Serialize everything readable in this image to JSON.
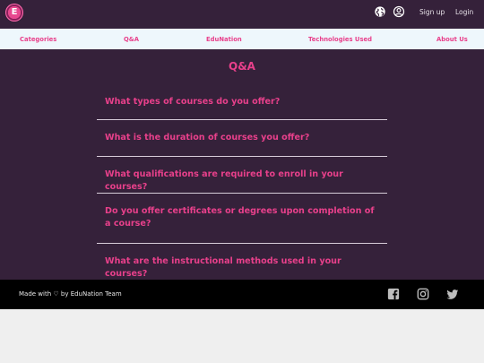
{
  "header": {
    "logo_letter": "E",
    "icons": [
      "globe-icon",
      "user-circle-icon"
    ],
    "signup_label": "Sign up",
    "login_label": "Login"
  },
  "nav": {
    "items": [
      "Categories",
      "Q&A",
      "EduNation",
      "Technologies Used",
      "About Us"
    ]
  },
  "main": {
    "title": "Q&A",
    "questions": [
      "What types of courses do you offer?",
      "What is the duration of courses you offer?",
      "What qualifications are required to enroll in your courses?",
      "Do you offer certificates or degrees upon completion of a course?",
      "What are the instructional methods used in your courses?"
    ]
  },
  "footer": {
    "text": "Made with ♡ by EduNation Team",
    "icons": [
      "facebook-icon",
      "instagram-icon",
      "twitter-icon"
    ]
  },
  "colors": {
    "dark_bg": "#35213a",
    "accent": "#e8408b",
    "nav_bg": "#eef7fc",
    "footer_bg": "#000000"
  }
}
